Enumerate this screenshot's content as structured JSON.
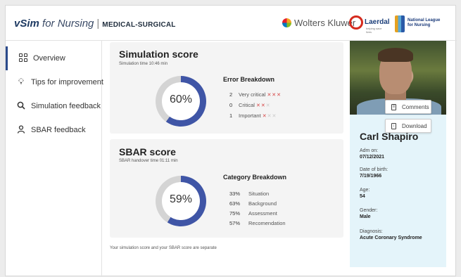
{
  "header": {
    "brand_v": "vSim",
    "brand_for": " for Nursing",
    "brand_sep": "|",
    "brand_module": "MEDICAL-SURGICAL",
    "partner1": "Wolters Kluwer",
    "partner2": "Laerdal",
    "partner2_tagline": "helping save lives",
    "partner3_line1": "National League",
    "partner3_line2": "for Nursing"
  },
  "sidebar": {
    "items": [
      {
        "label": "Overview",
        "icon": "grid-icon",
        "active": true
      },
      {
        "label": "Tips for improvement",
        "icon": "lightbulb-icon",
        "active": false
      },
      {
        "label": "Simulation feedback",
        "icon": "search-icon",
        "active": false
      },
      {
        "label": "SBAR feedback",
        "icon": "person-icon",
        "active": false
      }
    ]
  },
  "simulation": {
    "title": "Simulation score",
    "subtitle": "Simulation time 10:46 min",
    "percent": 60,
    "percent_label": "60%",
    "breakdown_title": "Error Breakdown",
    "rows": [
      {
        "count": "2",
        "label": "Very critical",
        "marks_on": 3,
        "marks_total": 3
      },
      {
        "count": "0",
        "label": "Critical",
        "marks_on": 2,
        "marks_total": 3
      },
      {
        "count": "1",
        "label": "Important",
        "marks_on": 1,
        "marks_total": 3
      }
    ]
  },
  "sbar": {
    "title": "SBAR score",
    "subtitle": "SBAR handover time 01:11 min",
    "percent": 59,
    "percent_label": "59%",
    "breakdown_title": "Category Breakdown",
    "rows": [
      {
        "pct": "33%",
        "label": "Situation"
      },
      {
        "pct": "63%",
        "label": "Background"
      },
      {
        "pct": "75%",
        "label": "Assessment"
      },
      {
        "pct": "57%",
        "label": "Recomendation"
      }
    ]
  },
  "footer_note": "Your simulation score and your SBAR score are separate",
  "patient": {
    "comments_label": "Comments",
    "download_label": "Download",
    "name": "Carl Shapiro",
    "adm_label": "Adm on:",
    "adm_value": "07/12/2021",
    "dob_label": "Date of birth:",
    "dob_value": "7/19/1966",
    "age_label": "Age:",
    "age_value": "54",
    "gender_label": "Gender:",
    "gender_value": "Male",
    "diag_label": "Diagnosis:",
    "diag_value": "Acute Coronary Syndrome"
  },
  "colors": {
    "donut_fill": "#3f55a6",
    "donut_track": "#d4d4d4",
    "error_mark": "#d64545",
    "accent": "#2b4a8b",
    "patient_bg": "#e4f4fa"
  }
}
